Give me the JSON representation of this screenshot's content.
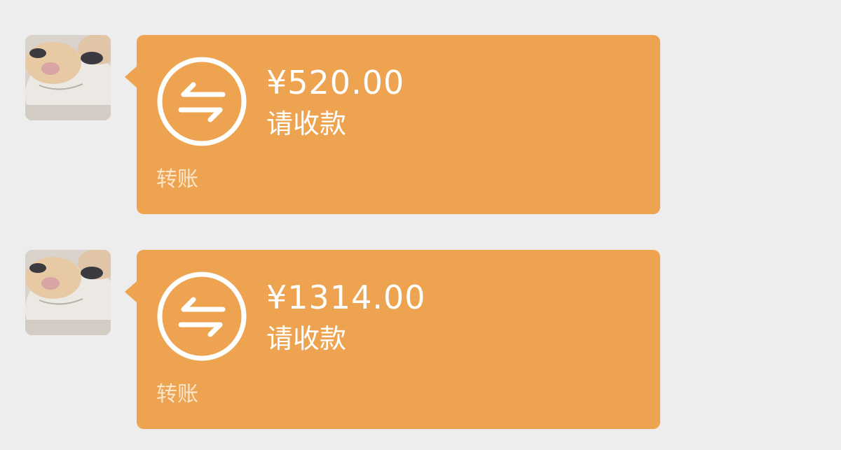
{
  "messages": [
    {
      "amount": "¥520.00",
      "status": "请收款",
      "footer": "转账",
      "icon": "transfer-arrows-icon",
      "avatar": "cat-avatar"
    },
    {
      "amount": "¥1314.00",
      "status": "请收款",
      "footer": "转账",
      "icon": "transfer-arrows-icon",
      "avatar": "cat-avatar"
    }
  ],
  "colors": {
    "background": "#ededed",
    "bubble": "#eda34f",
    "text": "#ffffff",
    "footer_text": "#fbe6cc"
  }
}
